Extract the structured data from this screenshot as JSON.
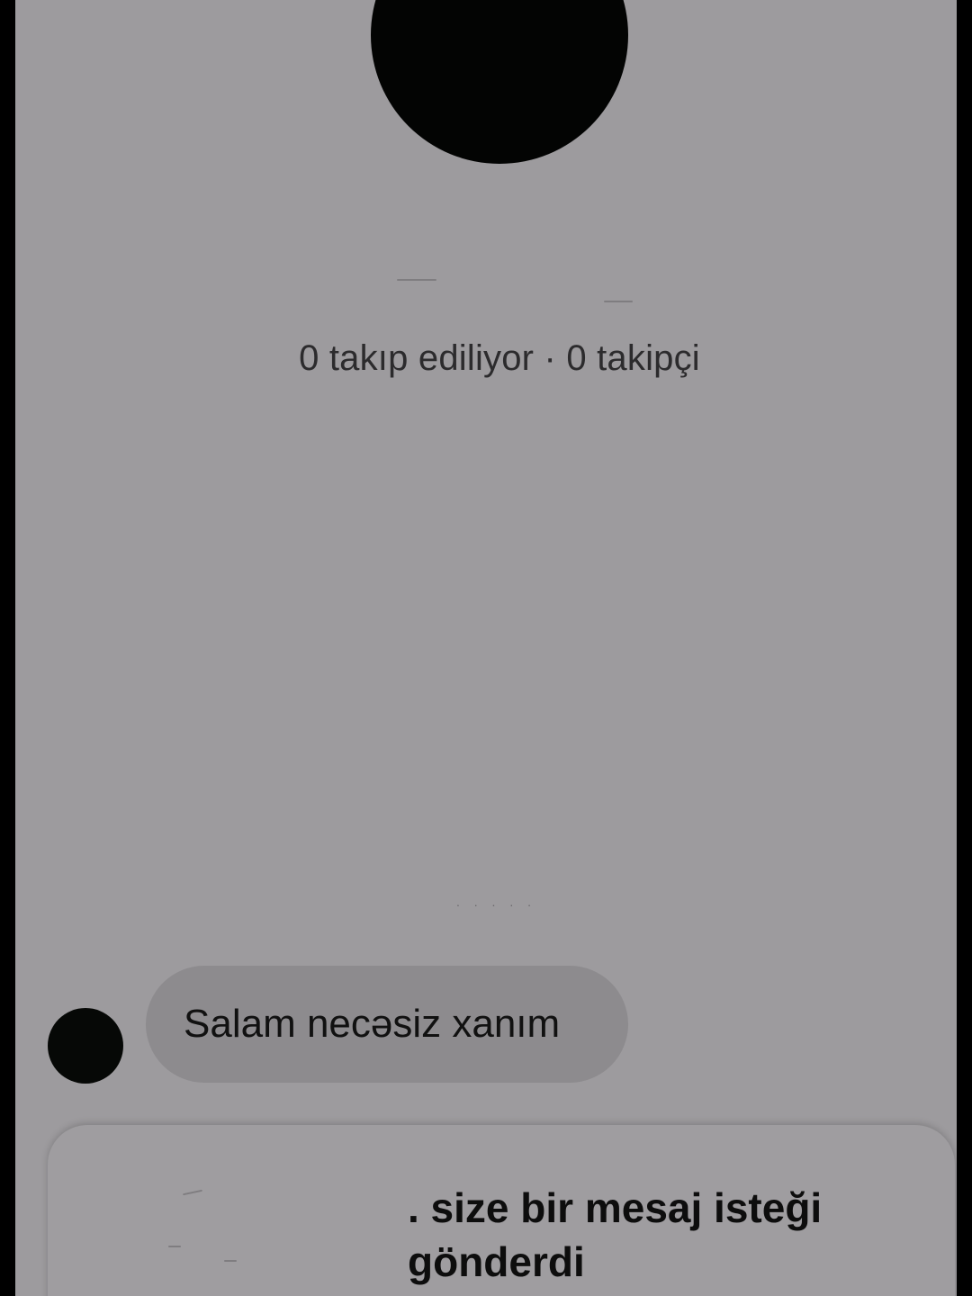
{
  "profile": {
    "stats_text": "0 takıp ediliyor · 0 takipçi"
  },
  "thread": {
    "dots": ". . .  . ."
  },
  "messages": [
    {
      "text": "Salam necəsiz xanım"
    }
  ],
  "request_banner": {
    "text": ". size bir mesaj isteği gönderdi"
  }
}
